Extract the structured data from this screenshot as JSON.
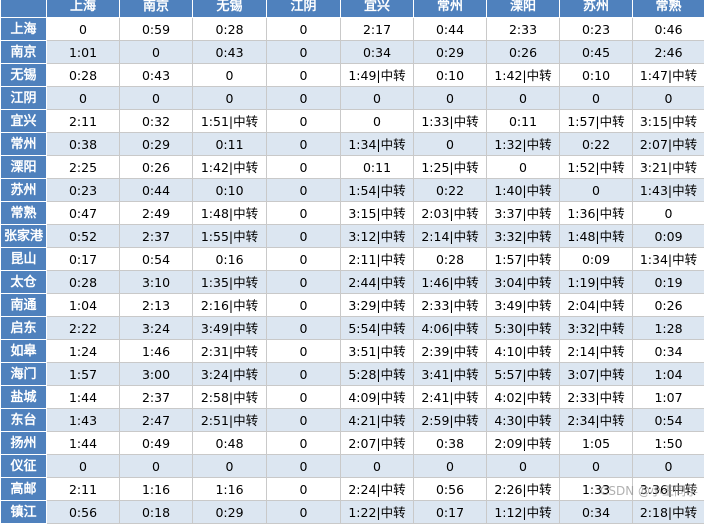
{
  "columns": [
    "上海",
    "南京",
    "无锡",
    "江阴",
    "宜兴",
    "常州",
    "溧阳",
    "苏州",
    "常熟"
  ],
  "rows": [
    {
      "name": "上海",
      "cells": [
        "0",
        "0:59",
        "0:28",
        "0",
        "2:17",
        "0:44",
        "2:33",
        "0:23",
        "0:46"
      ]
    },
    {
      "name": "南京",
      "cells": [
        "1:01",
        "0",
        "0:43",
        "0",
        "0:34",
        "0:29",
        "0:26",
        "0:45",
        "2:46"
      ]
    },
    {
      "name": "无锡",
      "cells": [
        "0:28",
        "0:43",
        "0",
        "0",
        "1:49|中转",
        "0:10",
        "1:42|中转",
        "0:10",
        "1:47|中转"
      ]
    },
    {
      "name": "江阴",
      "cells": [
        "0",
        "0",
        "0",
        "0",
        "0",
        "0",
        "0",
        "0",
        "0"
      ]
    },
    {
      "name": "宜兴",
      "cells": [
        "2:11",
        "0:32",
        "1:51|中转",
        "0",
        "0",
        "1:33|中转",
        "0:11",
        "1:57|中转",
        "3:15|中转"
      ]
    },
    {
      "name": "常州",
      "cells": [
        "0:38",
        "0:29",
        "0:11",
        "0",
        "1:34|中转",
        "0",
        "1:32|中转",
        "0:22",
        "2:07|中转"
      ]
    },
    {
      "name": "溧阳",
      "cells": [
        "2:25",
        "0:26",
        "1:42|中转",
        "0",
        "0:11",
        "1:25|中转",
        "0",
        "1:52|中转",
        "3:21|中转"
      ]
    },
    {
      "name": "苏州",
      "cells": [
        "0:23",
        "0:44",
        "0:10",
        "0",
        "1:54|中转",
        "0:22",
        "1:40|中转",
        "0",
        "1:43|中转"
      ]
    },
    {
      "name": "常熟",
      "cells": [
        "0:47",
        "2:49",
        "1:48|中转",
        "0",
        "3:15|中转",
        "2:03|中转",
        "3:37|中转",
        "1:36|中转",
        "0"
      ]
    },
    {
      "name": "张家港",
      "cells": [
        "0:52",
        "2:37",
        "1:55|中转",
        "0",
        "3:12|中转",
        "2:14|中转",
        "3:32|中转",
        "1:48|中转",
        "0:09"
      ]
    },
    {
      "name": "昆山",
      "cells": [
        "0:17",
        "0:54",
        "0:16",
        "0",
        "2:11|中转",
        "0:28",
        "1:57|中转",
        "0:09",
        "1:34|中转"
      ]
    },
    {
      "name": "太仓",
      "cells": [
        "0:28",
        "3:10",
        "1:35|中转",
        "0",
        "2:44|中转",
        "1:46|中转",
        "3:04|中转",
        "1:19|中转",
        "0:19"
      ]
    },
    {
      "name": "南通",
      "cells": [
        "1:04",
        "2:13",
        "2:16|中转",
        "0",
        "3:29|中转",
        "2:33|中转",
        "3:49|中转",
        "2:04|中转",
        "0:26"
      ]
    },
    {
      "name": "启东",
      "cells": [
        "2:22",
        "3:24",
        "3:49|中转",
        "0",
        "5:54|中转",
        "4:06|中转",
        "5:30|中转",
        "3:32|中转",
        "1:28"
      ]
    },
    {
      "name": "如皋",
      "cells": [
        "1:24",
        "1:46",
        "2:31|中转",
        "0",
        "3:51|中转",
        "2:39|中转",
        "4:10|中转",
        "2:14|中转",
        "0:34"
      ]
    },
    {
      "name": "海门",
      "cells": [
        "1:57",
        "3:00",
        "3:24|中转",
        "0",
        "5:28|中转",
        "3:41|中转",
        "5:57|中转",
        "3:07|中转",
        "1:04"
      ]
    },
    {
      "name": "盐城",
      "cells": [
        "1:44",
        "2:37",
        "2:58|中转",
        "0",
        "4:09|中转",
        "2:41|中转",
        "4:02|中转",
        "2:33|中转",
        "1:07"
      ]
    },
    {
      "name": "东台",
      "cells": [
        "1:43",
        "2:47",
        "2:51|中转",
        "0",
        "4:21|中转",
        "2:59|中转",
        "4:30|中转",
        "2:34|中转",
        "0:54"
      ]
    },
    {
      "name": "扬州",
      "cells": [
        "1:44",
        "0:49",
        "0:48",
        "0",
        "2:07|中转",
        "0:38",
        "2:09|中转",
        "1:05",
        "1:50"
      ]
    },
    {
      "name": "仪征",
      "cells": [
        "0",
        "0",
        "0",
        "0",
        "0",
        "0",
        "0",
        "0",
        "0"
      ]
    },
    {
      "name": "高邮",
      "cells": [
        "2:11",
        "1:16",
        "1:16",
        "0",
        "2:24|中转",
        "0:56",
        "2:26|中转",
        "1:33",
        "3:36|中转"
      ]
    },
    {
      "name": "镇江",
      "cells": [
        "0:56",
        "0:18",
        "0:29",
        "0",
        "1:22|中转",
        "0:17",
        "1:12|中转",
        "0:34",
        "2:18|中转"
      ]
    }
  ],
  "watermark": "CSDN @小王同学",
  "colors": {
    "header_bg": "#4f81bd",
    "header_text": "#ffffff",
    "stripe": "#dce6f1"
  }
}
